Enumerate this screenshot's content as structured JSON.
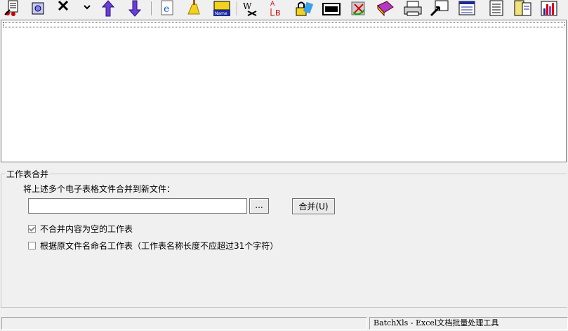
{
  "toolbar": {
    "icons": [
      "report-icon",
      "gear-icon",
      "delete-icon",
      "move-up-icon",
      "move-down-icon",
      "ie-icon",
      "broom-icon",
      "name-icon",
      "word-icon",
      "ab-icon",
      "lock-icon",
      "printer-dialog-icon",
      "recycle-icon",
      "book-icon",
      "printer-icon",
      "export-icon",
      "worksheet-icon",
      "document-icon",
      "notes-icon",
      "chart-icon"
    ]
  },
  "group": {
    "title": "工作表合并",
    "instruction": "将上述多个电子表格文件合并到新文件：",
    "filename_value": "",
    "browse_label": "...",
    "merge_label": "合并(U)",
    "option1_label": "不合并内容为空的工作表",
    "option1_checked": true,
    "option2_label": "根据原文件名命名工作表（工作表名称长度不应超过31个字符）",
    "option2_checked": false
  },
  "status": {
    "left_text": "",
    "right_text": "BatchXls - Excel文档批量处理工具"
  }
}
